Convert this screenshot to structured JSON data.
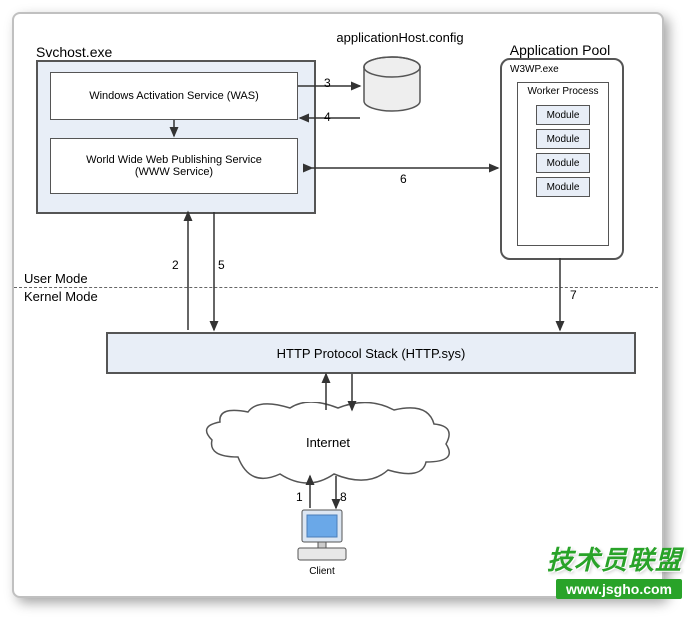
{
  "labels": {
    "svchost": "Svchost.exe",
    "was": "Windows Activation Service (WAS)",
    "www_line1": "World Wide Web Publishing Service",
    "www_line2": "(WWW Service)",
    "apphost": "applicationHost.config",
    "apppool": "Application Pool",
    "w3wp": "W3WP.exe",
    "worker": "Worker Process",
    "module": "Module",
    "usermode": "User Mode",
    "kernelmode": "Kernel Mode",
    "httpsys": "HTTP Protocol Stack (HTTP.sys)",
    "internet": "Internet",
    "client": "Client"
  },
  "numbers": {
    "n1": "1",
    "n2": "2",
    "n3": "3",
    "n4": "4",
    "n5": "5",
    "n6": "6",
    "n7": "7",
    "n8": "8"
  },
  "watermark": {
    "title": "技术员联盟",
    "url": "www.jsgho.com"
  }
}
